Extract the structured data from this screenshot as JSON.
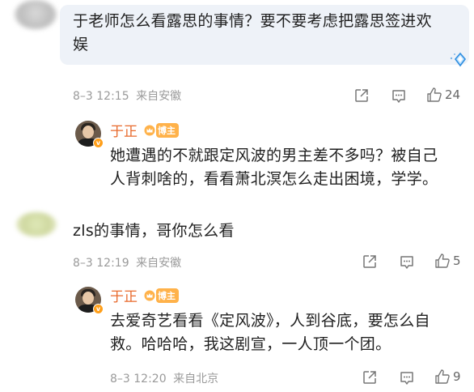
{
  "comments": [
    {
      "text_line1": "于老师怎么看露思的事情？要不要考虑把露思签进欢",
      "text_line2": "娱",
      "time": "8–3 12:15",
      "source": "来自安徽",
      "likes": "24",
      "reply": {
        "author": "于正",
        "badge": "博主",
        "text_line1": "她遭遇的不就跟定风波的男主差不多吗？被自己",
        "text_line2": "人背刺啥的，看看萧北溟怎么走出困境，学学。"
      }
    },
    {
      "text_line1": "zls的事情，哥你怎么看",
      "time": "8–3 12:19",
      "source": "来自安徽",
      "likes": "5",
      "reply": {
        "author": "于正",
        "badge": "博主",
        "text_line1": "去爱奇艺看看《定风波》，人到谷底，要怎么自",
        "text_line2": "救。哈哈哈，我这剧宣，一人顶一个团。",
        "time": "8–3 12:20",
        "source": "来自北京",
        "likes": "9"
      }
    }
  ],
  "icons": {
    "share": "share-icon",
    "comment": "comment-icon",
    "like": "thumbs-up-icon",
    "diamond": "diamond-badge-icon",
    "crown": "crown-icon"
  },
  "colors": {
    "author": "#e86a2c",
    "badge": "#ffb24a",
    "bubble": "#eef2f8"
  }
}
